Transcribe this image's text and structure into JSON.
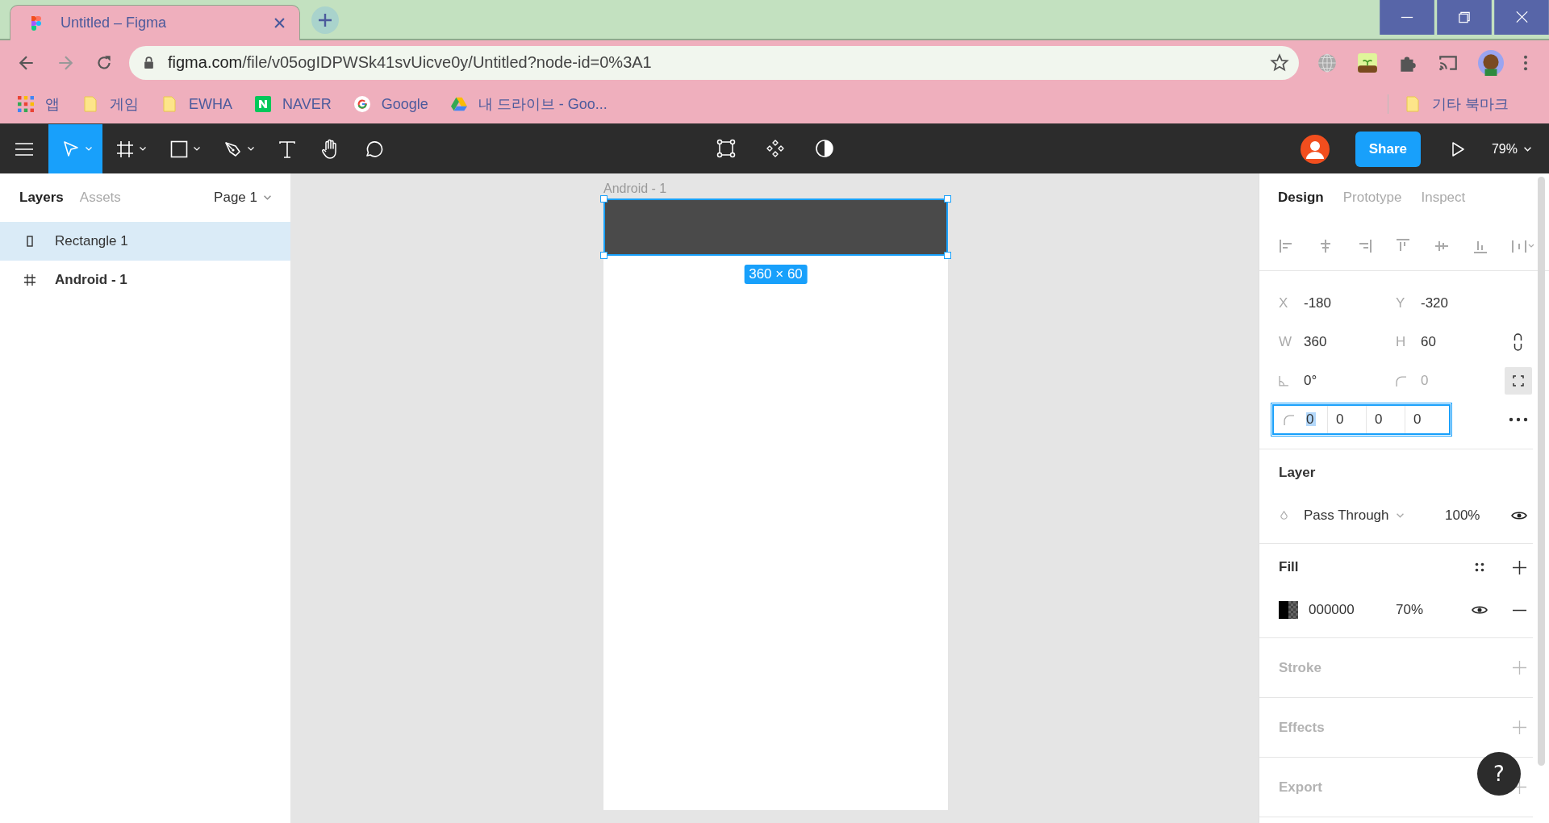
{
  "browser": {
    "tab": {
      "title": "Untitled – Figma"
    },
    "address": {
      "host": "figma.com",
      "path": "/file/v05ogIDPWSk41svUicve0y/Untitled?node-id=0%3A1"
    },
    "bookmarks": [
      {
        "label": "앱",
        "kind": "apps"
      },
      {
        "label": "게임",
        "kind": "folder"
      },
      {
        "label": "EWHA",
        "kind": "folder"
      },
      {
        "label": "NAVER",
        "kind": "naver"
      },
      {
        "label": "Google",
        "kind": "google"
      },
      {
        "label": "내 드라이브 - Goo...",
        "kind": "drive"
      }
    ],
    "other_bookmarks": "기타 북마크"
  },
  "toolbar": {
    "tools": [
      {
        "kind": "move",
        "selected": true,
        "has_menu": true
      },
      {
        "kind": "frame",
        "selected": false,
        "has_menu": true
      },
      {
        "kind": "rectangle",
        "selected": false,
        "has_menu": true
      },
      {
        "kind": "pen",
        "selected": false,
        "has_menu": true
      },
      {
        "kind": "text",
        "selected": false,
        "has_menu": false
      },
      {
        "kind": "hand",
        "selected": false,
        "has_menu": false
      },
      {
        "kind": "comment",
        "selected": false,
        "has_menu": false
      }
    ],
    "share": "Share",
    "zoom": "79%"
  },
  "left_panel": {
    "tabs": [
      {
        "label": "Layers",
        "selected": true
      },
      {
        "label": "Assets",
        "selected": false
      }
    ],
    "page": "Page 1",
    "layers": [
      {
        "name": "Rectangle 1",
        "kind": "rectangle",
        "selected": true
      },
      {
        "name": "Android - 1",
        "kind": "frame",
        "selected": false
      }
    ]
  },
  "canvas": {
    "frame_label": "Android - 1",
    "size_badge": "360 × 60"
  },
  "right_panel": {
    "tabs": [
      {
        "label": "Design",
        "selected": true
      },
      {
        "label": "Prototype",
        "selected": false
      },
      {
        "label": "Inspect",
        "selected": false
      }
    ],
    "x": {
      "label": "X",
      "value": "-180"
    },
    "y": {
      "label": "Y",
      "value": "-320"
    },
    "w": {
      "label": "W",
      "value": "360"
    },
    "h": {
      "label": "H",
      "value": "60"
    },
    "rotation": "0°",
    "radius": "0",
    "corners": [
      {
        "value": "0",
        "selected": true
      },
      {
        "value": "0",
        "selected": false
      },
      {
        "value": "0",
        "selected": false
      },
      {
        "value": "0",
        "selected": false
      }
    ],
    "layer": {
      "title": "Layer",
      "blend": "Pass Through",
      "opacity": "100%"
    },
    "fill": {
      "title": "Fill",
      "hex": "000000",
      "opacity": "70%"
    },
    "empty_sections": [
      {
        "title": "Stroke"
      },
      {
        "title": "Effects"
      },
      {
        "title": "Export"
      }
    ],
    "help": "?"
  }
}
